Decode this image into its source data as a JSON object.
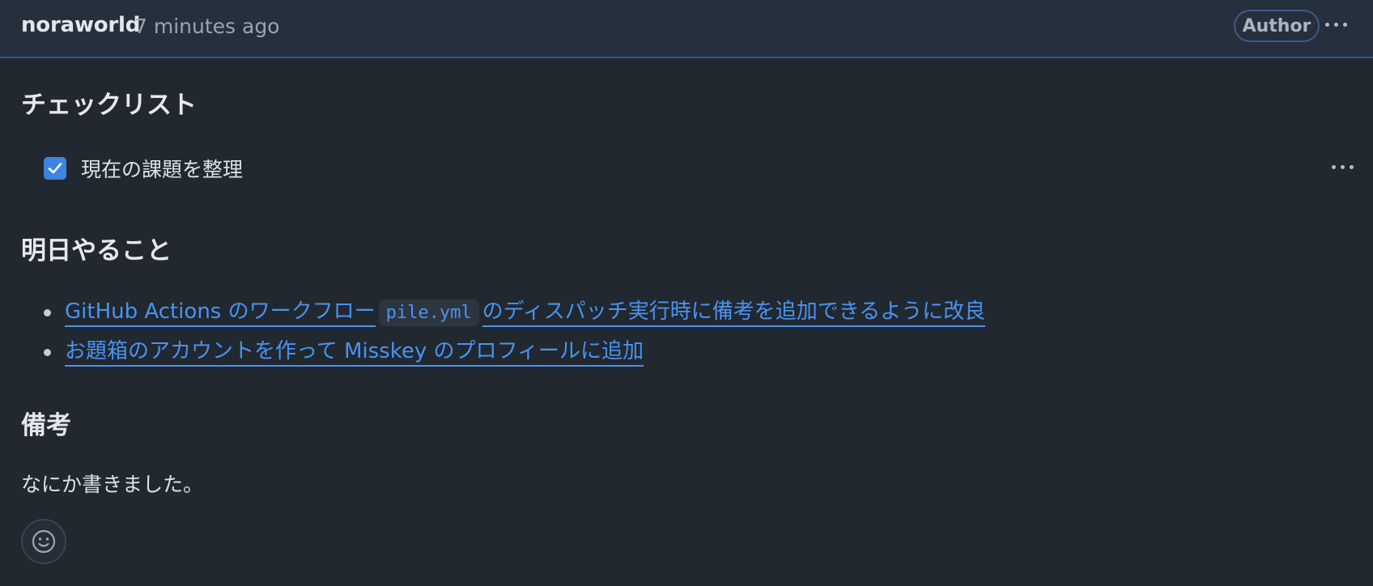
{
  "header": {
    "author": "noraworld",
    "timestamp": "7 minutes ago",
    "badge": "Author",
    "menu_icon": "kebab-horizontal-icon"
  },
  "sections": {
    "checklist_heading": "チェックリスト",
    "tasks": [
      {
        "label": "現在の課題を整理",
        "checked": true
      }
    ],
    "tomorrow_heading": "明日やること",
    "tomorrow_items": [
      {
        "text_before": "GitHub Actions のワークフロー",
        "code": "pile.yml",
        "text_after": "のディスパッチ実行時に備考を追加できるように改良"
      },
      {
        "text": "お題箱のアカウントを作って Misskey のプロフィールに追加"
      }
    ],
    "notes_heading": "備考",
    "notes_text": "なにか書きました。"
  },
  "colors": {
    "background": "#212830",
    "header_background": "#262f3c",
    "link": "#4a93f0",
    "checkbox": "#3c84e0"
  },
  "reaction_icon": "smiley-icon"
}
